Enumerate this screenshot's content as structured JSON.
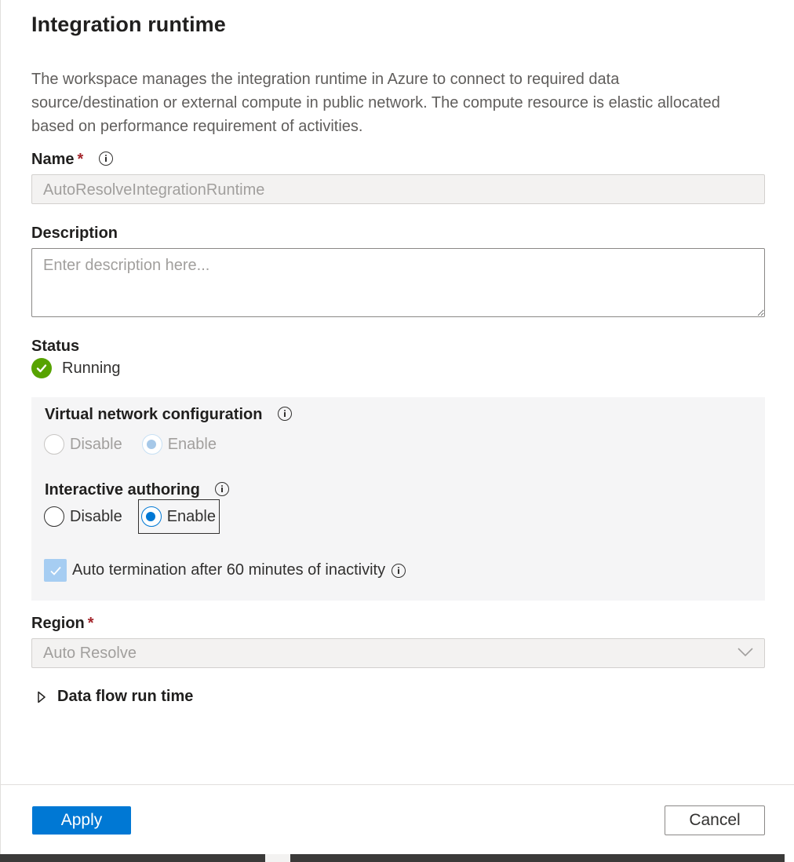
{
  "panel": {
    "title": "Integration runtime",
    "intro": "The workspace manages the integration runtime in Azure to connect to required data source/destination or external compute in public network. The compute resource is elastic allocated based on performance requirement of activities."
  },
  "name": {
    "label": "Name",
    "required_mark": "*",
    "value": "AutoResolveIntegrationRuntime"
  },
  "description": {
    "label": "Description",
    "placeholder": "Enter description here..."
  },
  "status": {
    "label": "Status",
    "value": "Running",
    "color": "#57a300"
  },
  "virtual_network": {
    "label": "Virtual network configuration",
    "options": [
      "Disable",
      "Enable"
    ],
    "selected": "Enable",
    "disabled": true
  },
  "interactive_authoring": {
    "label": "Interactive authoring",
    "options": [
      "Disable",
      "Enable"
    ],
    "selected": "Enable"
  },
  "auto_termination": {
    "label": "Auto termination after 60 minutes of inactivity",
    "checked": true
  },
  "region": {
    "label": "Region",
    "required_mark": "*",
    "value": "Auto Resolve"
  },
  "data_flow": {
    "label": "Data flow run time",
    "expanded": false
  },
  "footer": {
    "apply_label": "Apply",
    "cancel_label": "Cancel"
  },
  "colors": {
    "accent": "#0078d4",
    "required": "#a4262c"
  }
}
